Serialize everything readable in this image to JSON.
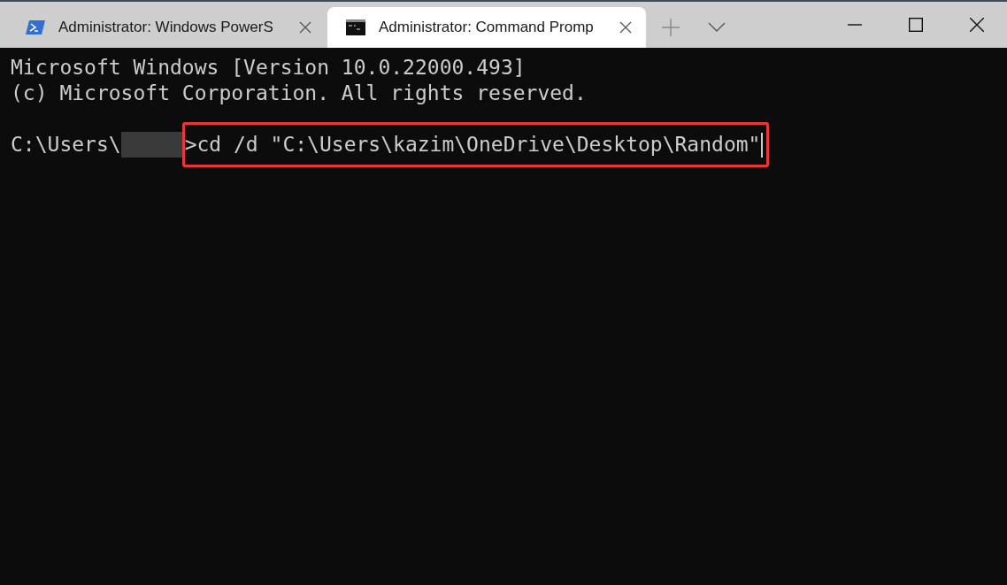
{
  "tabs": [
    {
      "kind": "powershell",
      "title": "Administrator: Windows PowerS",
      "selected": false
    },
    {
      "kind": "cmd",
      "title": "Administrator: Command Promp",
      "selected": true
    }
  ],
  "terminal": {
    "lines": [
      "Microsoft Windows [Version 10.0.22000.493]",
      "(c) Microsoft Corporation. All rights reserved."
    ],
    "prompt": {
      "path_start": "C:\\Users\\",
      "redacted": true,
      "prompt_end": ">",
      "command": "cd /d \"C:\\Users\\kazim\\OneDrive\\Desktop\\Random\"",
      "highlighted": true,
      "cursor": true
    }
  }
}
